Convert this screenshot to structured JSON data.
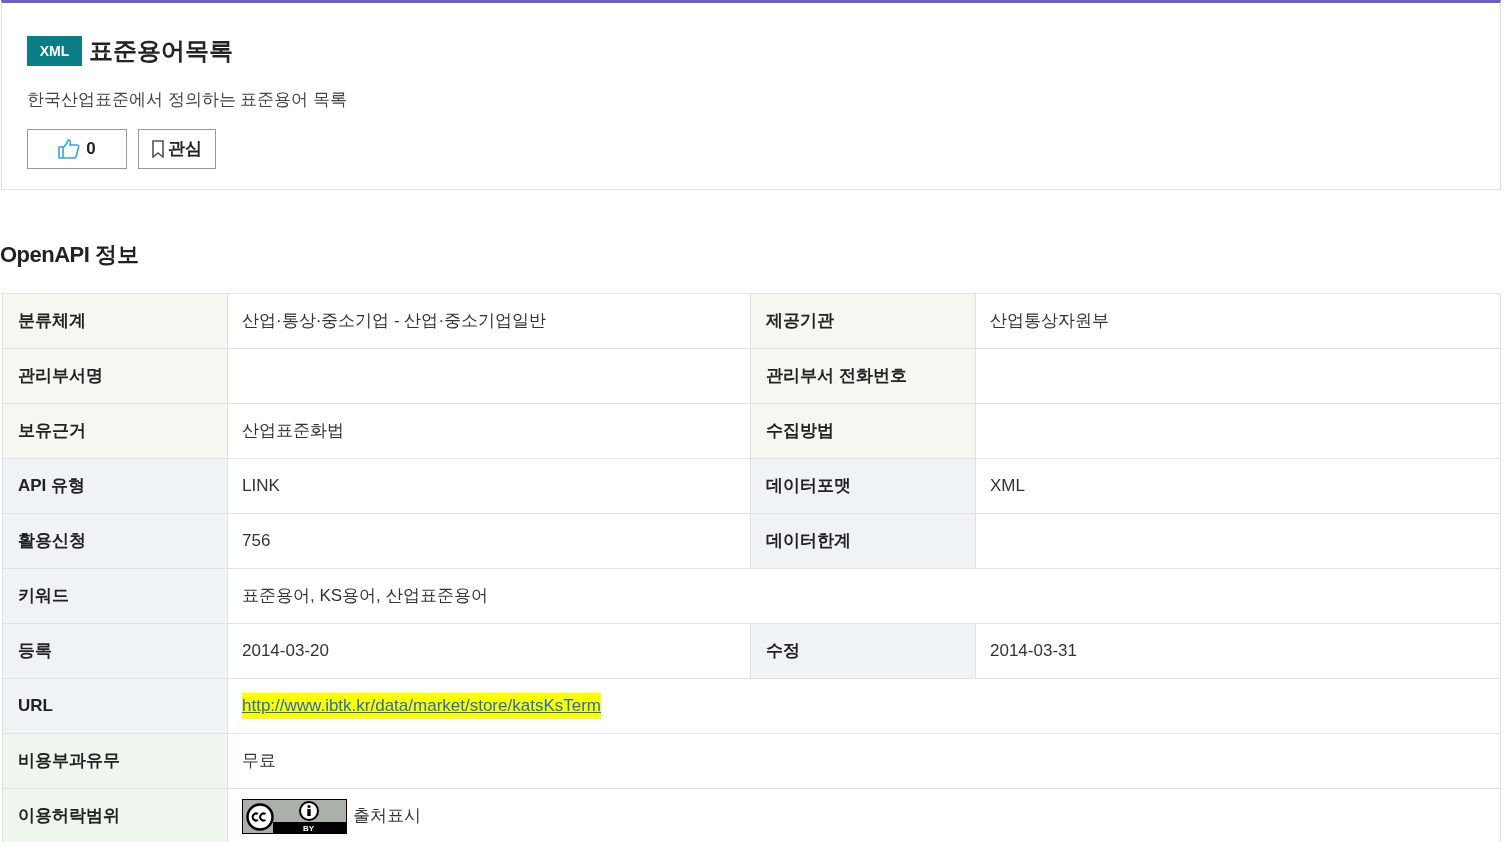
{
  "header": {
    "format_badge": "XML",
    "title": "표준용어목록",
    "description": "한국산업표준에서 정의하는 표준용어 목록",
    "like_button": {
      "count": "0"
    },
    "bookmark_button": {
      "label": "관심"
    }
  },
  "section_title": "OpenAPI 정보",
  "table": {
    "rows": [
      {
        "kind": "basic",
        "cells": [
          {
            "label": "분류체계",
            "value": "산업·통상·중소기업 - 산업·중소기업일반"
          },
          {
            "label": "제공기관",
            "value": "산업통상자원부"
          }
        ]
      },
      {
        "kind": "basic",
        "cells": [
          {
            "label": "관리부서명"
          },
          {
            "label": "관리부서 전화번호"
          }
        ]
      },
      {
        "kind": "basic",
        "cells": [
          {
            "label": "보유근거",
            "value": "산업표준화법"
          },
          {
            "label": "수집방법"
          }
        ]
      },
      {
        "kind": "api",
        "cells": [
          {
            "label": "API 유형",
            "value": "LINK"
          },
          {
            "label": "데이터포맷",
            "value": "XML"
          }
        ]
      },
      {
        "kind": "api",
        "cells": [
          {
            "label": "활용신청",
            "value": "756"
          },
          {
            "label": "데이터한계"
          }
        ]
      },
      {
        "kind": "api",
        "cells": [
          {
            "label": "키워드",
            "value": "표준용어, KS용어, 산업표준용어"
          }
        ]
      },
      {
        "kind": "api",
        "cells": [
          {
            "label": "등록",
            "value": "2014-03-20"
          },
          {
            "label": "수정",
            "value": "2014-03-31"
          }
        ]
      },
      {
        "kind": "api",
        "cells": [
          {
            "label": "URL",
            "kind": "link",
            "value": "http://www.ibtk.kr/data/market/store/katsKsTerm"
          }
        ]
      },
      {
        "kind": "license",
        "cells": [
          {
            "label": "비용부과유무",
            "value": "무료"
          }
        ]
      },
      {
        "kind": "license",
        "cells": [
          {
            "label": "이용허락범위",
            "kind": "license",
            "badge": "BY",
            "value": "출처표시"
          }
        ]
      }
    ]
  }
}
